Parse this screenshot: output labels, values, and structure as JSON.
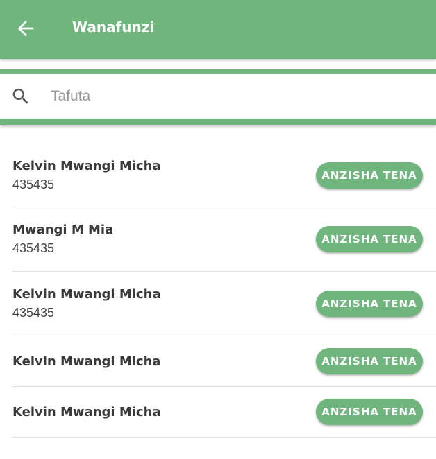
{
  "appbar": {
    "title": "Wanafunzi",
    "back_icon": "arrow-left-icon"
  },
  "search": {
    "placeholder": "Tafuta",
    "value": "",
    "icon": "search-icon"
  },
  "colors": {
    "primary": "#70b47e"
  },
  "students": [
    {
      "name": "Kelvin Mwangi Micha",
      "id": "435435",
      "action": "ANZISHA TENA"
    },
    {
      "name": "Mwangi M Mia",
      "id": "435435",
      "action": "ANZISHA TENA"
    },
    {
      "name": "Kelvin Mwangi Micha",
      "id": "435435",
      "action": "ANZISHA TENA"
    },
    {
      "name": "Kelvin Mwangi Micha",
      "action": "ANZISHA TENA"
    },
    {
      "name": "Kelvin Mwangi Micha",
      "action": "ANZISHA TENA"
    }
  ]
}
